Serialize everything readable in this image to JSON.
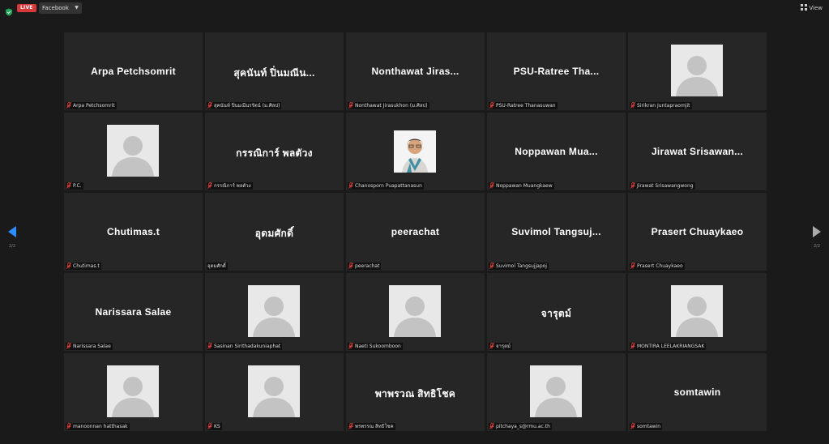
{
  "topbar": {
    "live_label": "LIVE",
    "stream_target": "Facebook",
    "view_label": "View"
  },
  "pager": {
    "left_page": "2/2",
    "right_page": "2/2"
  },
  "colors": {
    "live": "#d9383a",
    "muted_mic": "#e0443e",
    "shield": "#23a55a",
    "pager_arrow": "#2d8cff"
  },
  "tiles": [
    {
      "display": "Arpa Petchsomrit",
      "label": "Arpa Petchsomrit",
      "muted": true,
      "media": "name"
    },
    {
      "display": "สุคนันท์ ปิ่นมณีน...",
      "label": "สุคนันท์ ปิ่นมณีนรรัตน์ (ม.ศิลป)",
      "muted": true,
      "media": "name"
    },
    {
      "display": "Nonthawat Jiras...",
      "label": "Nonthawat Jirasukhon (ม.ศิลป)",
      "muted": true,
      "media": "name"
    },
    {
      "display": "PSU-Ratree Tha...",
      "label": "PSU-Ratree Thanasuwan",
      "muted": true,
      "media": "name"
    },
    {
      "display": "",
      "label": "Sirikran Juntapraomjit",
      "muted": true,
      "media": "avatar"
    },
    {
      "display": "",
      "label": "P.C.",
      "muted": true,
      "media": "avatar"
    },
    {
      "display": "กรรณิการ์ พลตัวง",
      "label": "กรรณิการ์ พลตัวง",
      "muted": true,
      "media": "name"
    },
    {
      "display": "",
      "label": "Chanosporn Puapattanasun",
      "muted": true,
      "media": "photo"
    },
    {
      "display": "Noppawan Mua...",
      "label": "Noppawan Muangkaew",
      "muted": true,
      "media": "name"
    },
    {
      "display": "Jirawat Srisawan...",
      "label": "Jirawat Srisawangwong",
      "muted": true,
      "media": "name"
    },
    {
      "display": "Chutimas.t",
      "label": "Chutimas.t",
      "muted": true,
      "media": "name"
    },
    {
      "display": "อุดมศักดิ์",
      "label": "อุดมศักดิ์",
      "muted": false,
      "media": "name"
    },
    {
      "display": "peerachat",
      "label": "peerachat",
      "muted": true,
      "media": "name"
    },
    {
      "display": "Suvimol Tangsuj...",
      "label": "Suvimol Tangsujjapoj",
      "muted": true,
      "media": "name"
    },
    {
      "display": "Prasert Chuaykaeo",
      "label": "Prasert Chuaykaeo",
      "muted": true,
      "media": "name"
    },
    {
      "display": "Narissara Salae",
      "label": "Narissara Salae",
      "muted": true,
      "media": "name"
    },
    {
      "display": "",
      "label": "Sasinan Sirithadakuniaphat",
      "muted": true,
      "media": "avatar"
    },
    {
      "display": "",
      "label": "Naeti Sukoomboon",
      "muted": true,
      "media": "avatar"
    },
    {
      "display": "จารุตม์",
      "label": "จารุตม์",
      "muted": true,
      "media": "name"
    },
    {
      "display": "",
      "label": "MONTIRA LEELAKRIANGSAK",
      "muted": true,
      "media": "avatar"
    },
    {
      "display": "",
      "label": "manoonnan hatthasak",
      "muted": true,
      "media": "avatar"
    },
    {
      "display": "",
      "label": "KS",
      "muted": true,
      "media": "avatar"
    },
    {
      "display": "พาพรวณ สิทธิโชค",
      "label": "พรพรรณ สิทธิโชค",
      "muted": true,
      "media": "name"
    },
    {
      "display": "",
      "label": "pitchaya_s@rmu.ac.th",
      "muted": true,
      "media": "avatar"
    },
    {
      "display": "somtawin",
      "label": "somtawin",
      "muted": true,
      "media": "name"
    }
  ]
}
